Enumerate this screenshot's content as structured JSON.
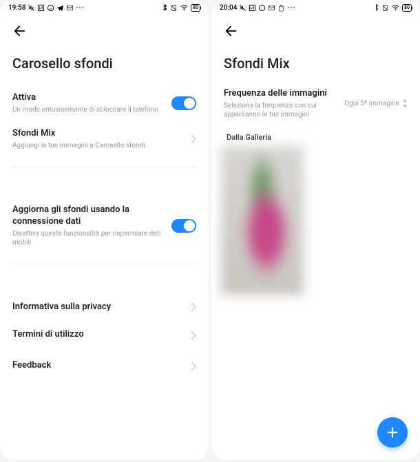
{
  "left": {
    "time": "19:58",
    "battery": "80",
    "title": "Carosello sfondi",
    "attiva": {
      "title": "Attiva",
      "sub": "Un modo entusiasmante di sbloccare il telefono"
    },
    "sfondiMix": {
      "title": "Sfondi Mix",
      "sub": "Aggiungi le tue immagini a Carosello sfondi"
    },
    "aggiorna": {
      "title": "Aggiorna gli sfondi usando la connessione dati",
      "sub": "Disattiva questa funzionalità per risparmiare dati mobili"
    },
    "privacy": "Informativa sulla privacy",
    "termini": "Termini di utilizzo",
    "feedback": "Feedback"
  },
  "right": {
    "time": "20:04",
    "battery": "80",
    "title": "Sfondi Mix",
    "freq": {
      "title": "Frequenza delle immagini",
      "sub": "Seleziona la frequenza con cui appariranno le tue immagini",
      "value": "Ogni 5ª immagine"
    },
    "gallery": "Dalla Galleria"
  }
}
